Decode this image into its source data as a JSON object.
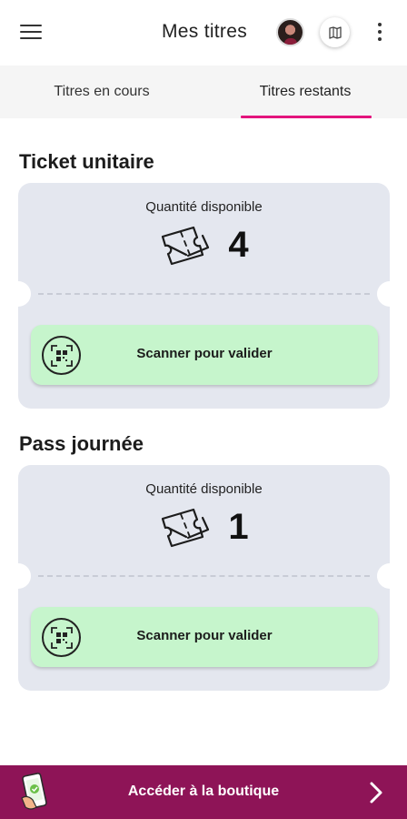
{
  "header": {
    "title": "Mes titres",
    "menu_icon": "hamburger-menu-icon",
    "avatar_icon": "user-avatar",
    "map_icon": "map-icon",
    "more_icon": "more-vert-icon"
  },
  "tabs": [
    {
      "label": "Titres en cours",
      "active": false
    },
    {
      "label": "Titres restants",
      "active": true
    }
  ],
  "accent_color": "#e3147c",
  "sections": [
    {
      "title": "Ticket unitaire",
      "quantity_label": "Quantité disponible",
      "quantity": "4",
      "ticket_icon": "tickets-icon",
      "scan_icon": "qr-scan-icon",
      "scan_label": "Scanner pour valider"
    },
    {
      "title": "Pass journée",
      "quantity_label": "Quantité disponible",
      "quantity": "1",
      "ticket_icon": "tickets-icon",
      "scan_icon": "qr-scan-icon",
      "scan_label": "Scanner pour valider"
    }
  ],
  "colors": {
    "card_bg": "#e4e7ef",
    "scan_button_bg": "#c6f5cc",
    "shop_bar_bg": "#8e1457"
  },
  "shop_bar": {
    "label": "Accéder à la boutique",
    "icon": "phone-shop-icon",
    "chevron_icon": "chevron-right-icon"
  }
}
